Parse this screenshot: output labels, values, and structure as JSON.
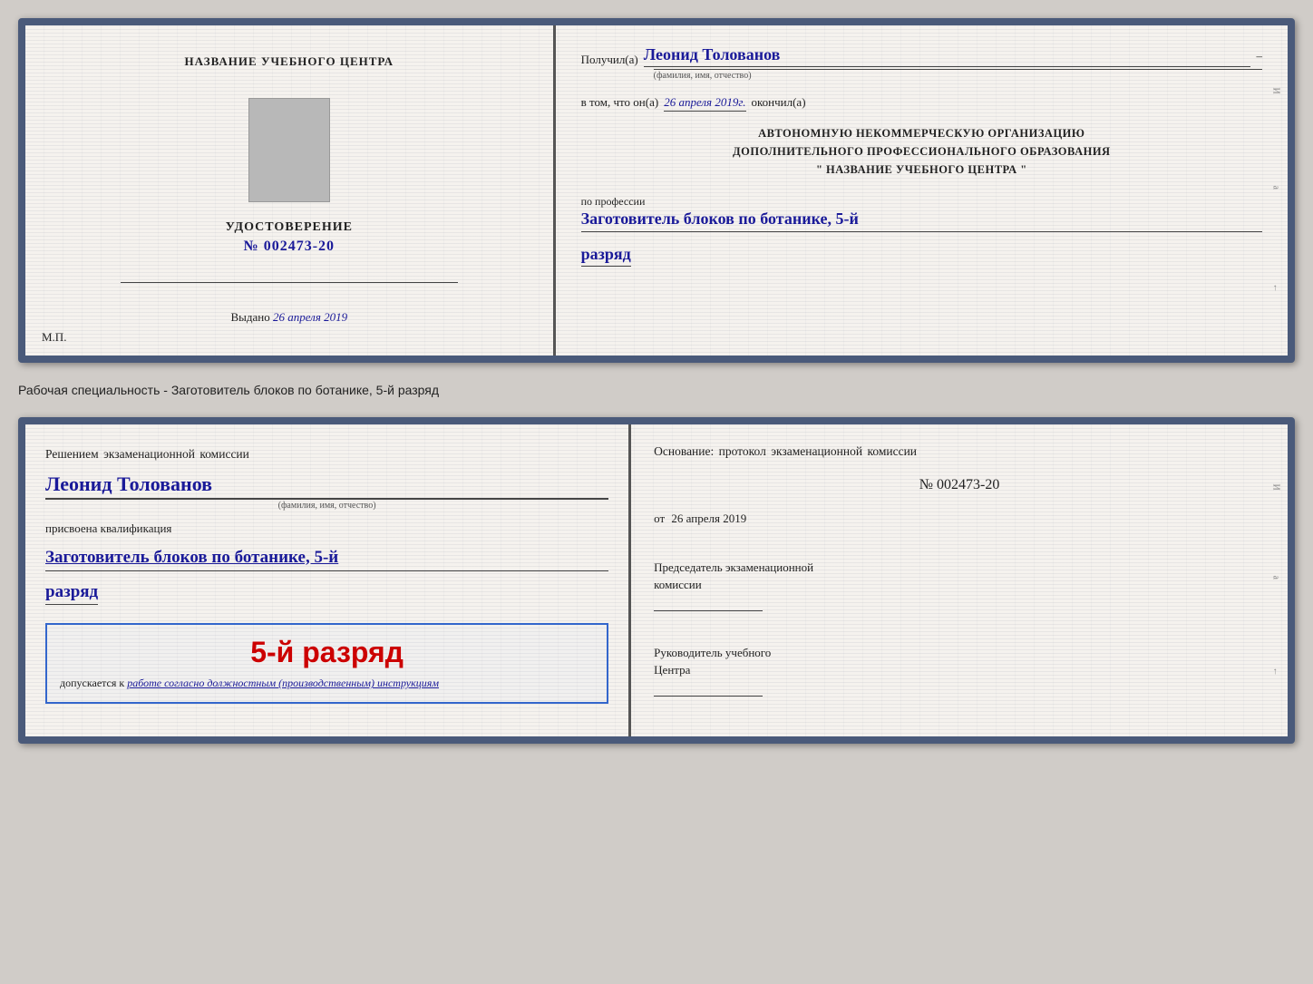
{
  "card1": {
    "left": {
      "center_name": "НАЗВАНИЕ УЧЕБНОГО ЦЕНТРА",
      "udost_label": "УДОСТОВЕРЕНИЕ",
      "udost_number": "№ 002473-20",
      "vydano_prefix": "Выдано",
      "vydano_date": "26 апреля 2019",
      "mp_label": "М.П."
    },
    "right": {
      "poluchil_prefix": "Получил(а)",
      "recipient_name": "Леонид Толованов",
      "fio_sublabel": "(фамилия, имя, отчество)",
      "vtom_prefix": "в том, что он(а)",
      "vtom_date": "26 апреля 2019г.",
      "okonchil": "окончил(а)",
      "org_line1": "АВТОНОМНУЮ НЕКОММЕРЧЕСКУЮ ОРГАНИЗАЦИЮ",
      "org_line2": "ДОПОЛНИТЕЛЬНОГО ПРОФЕССИОНАЛЬНОГО ОБРАЗОВАНИЯ",
      "org_line3": "\"   НАЗВАНИЕ УЧЕБНОГО ЦЕНТРА   \"",
      "po_professii": "по профессии",
      "profession": "Заготовитель блоков по ботанике, 5-й",
      "razryad": "разряд"
    }
  },
  "separator": {
    "text": "Рабочая специальность - Заготовитель блоков по ботанике, 5-й разряд"
  },
  "card2": {
    "left": {
      "resheniem": "Решением экзаменационной комиссии",
      "person_name": "Леонид Толованов",
      "fio_sublabel": "(фамилия, имя, отчество)",
      "prisvoena": "присвоена квалификация",
      "kval": "Заготовитель блоков по ботанике, 5-й",
      "razryad": "разряд",
      "razryad_big": "5-й разряд",
      "dopuskaetsya_prefix": "допускается к",
      "dopuskaetsya_italic": "работе согласно должностным (производственным) инструкциям"
    },
    "right": {
      "osnovanie": "Основание: протокол экзаменационной комиссии",
      "protocol_number": "№  002473-20",
      "ot_prefix": "от",
      "ot_date": "26 апреля 2019",
      "predsedatel_line1": "Председатель экзаменационной",
      "predsedatel_line2": "комиссии",
      "rukovoditel_line1": "Руководитель учебного",
      "rukovoditel_line2": "Центра"
    }
  }
}
